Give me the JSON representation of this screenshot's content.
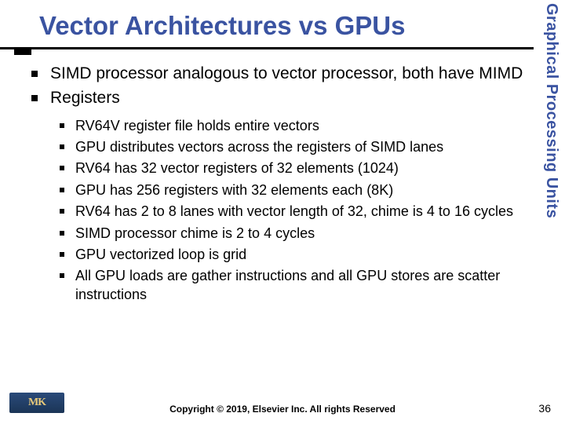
{
  "title": "Vector Architectures vs GPUs",
  "side_label": "Graphical Processing Units",
  "bullets": [
    {
      "text": "SIMD processor analogous to vector processor, both have MIMD"
    },
    {
      "text": "Registers"
    }
  ],
  "sub_bullets": [
    {
      "text": "RV64V register file holds entire vectors"
    },
    {
      "text": "GPU distributes vectors across the registers of SIMD lanes"
    },
    {
      "text": "RV64 has 32 vector registers of 32 elements (1024)"
    },
    {
      "text": "GPU has 256 registers with 32 elements each (8K)"
    },
    {
      "text": "RV64 has 2 to 8 lanes with vector length of 32, chime is 4 to 16 cycles"
    },
    {
      "text": "SIMD processor chime is 2 to 4 cycles"
    },
    {
      "text": "GPU vectorized loop is grid"
    },
    {
      "text": "All GPU loads are gather instructions and all GPU stores are scatter instructions"
    }
  ],
  "footer": {
    "copyright": "Copyright © 2019, Elsevier Inc. All rights Reserved",
    "page": "36",
    "logo_text": "MK"
  }
}
